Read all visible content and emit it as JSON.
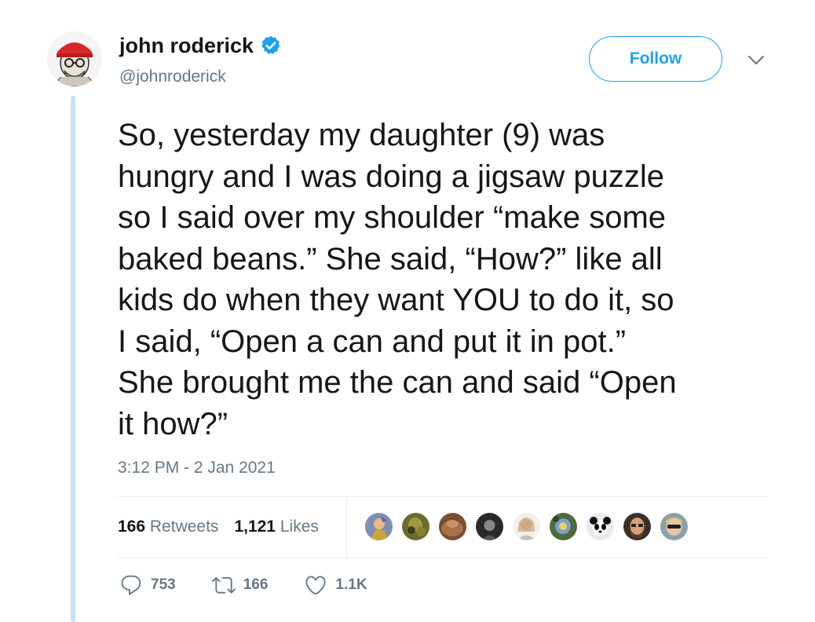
{
  "author": {
    "display_name": "john roderick",
    "handle": "@johnroderick",
    "verified": true,
    "avatar_icon": "caricature-avatar-red-cap"
  },
  "follow_label": "Follow",
  "tweet": {
    "lines": [
      "So, yesterday my daughter (9) was",
      "hungry and I was doing a jigsaw puzzle",
      "so I said over my shoulder “make some",
      "baked beans.” She said, “How?” like all",
      "kids do when they want YOU to do it, so",
      "I said, “Open a can and put it in pot.”",
      "She brought me the can and said “Open",
      "it how?”"
    ],
    "timestamp": "3:12 PM - 2 Jan 2021"
  },
  "stats": {
    "retweets_count": "166",
    "retweets_label": "Retweets",
    "likes_count": "1,121",
    "likes_label": "Likes"
  },
  "actions": {
    "replies": "753",
    "retweets": "166",
    "likes": "1.1K"
  },
  "colors": {
    "accent": "#1da1f2",
    "secondary_text": "#657786",
    "thread_line": "#c4e3f7"
  }
}
